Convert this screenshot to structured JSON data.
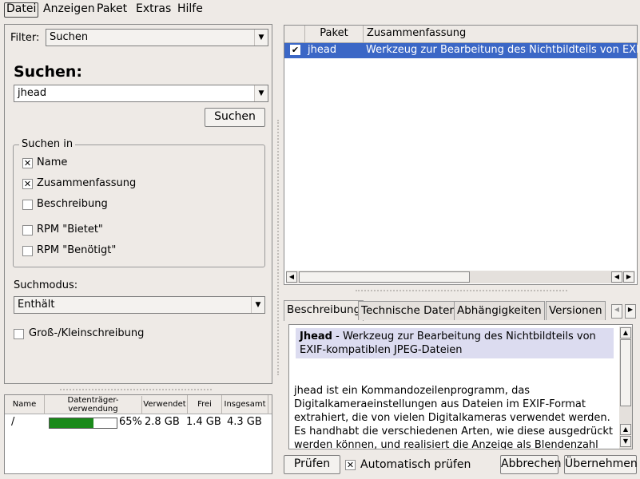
{
  "menu": {
    "items": [
      "Datei",
      "Anzeigen",
      "Paket",
      "Extras",
      "Hilfe"
    ]
  },
  "left": {
    "filter_label": "Filter:",
    "filter_value": "Suchen",
    "search_heading": "Suchen:",
    "search_value": "jhead",
    "search_button": "Suchen",
    "group_title": "Suchen in",
    "options": [
      {
        "label": "Name",
        "checked": true
      },
      {
        "label": "Zusammenfassung",
        "checked": true
      },
      {
        "label": "Beschreibung",
        "checked": false
      },
      {
        "label": "RPM \"Bietet\"",
        "checked": false
      },
      {
        "label": "RPM \"Benötigt\"",
        "checked": false
      }
    ],
    "mode_label": "Suchmodus:",
    "mode_value": "Enthält",
    "case_label": "Groß-/Kleinschreibung",
    "case_checked": false
  },
  "disk": {
    "headers": [
      "Name",
      "Datenträger-verwendung",
      "Verwendet",
      "Frei",
      "Insgesamt"
    ],
    "row": {
      "name": "/",
      "percent": "65%",
      "used": "2.8 GB",
      "free": "1.4 GB",
      "total": "4.3 GB",
      "fill": 0.65
    }
  },
  "packages": {
    "headers": [
      "Paket",
      "Zusammenfassung"
    ],
    "rows": [
      {
        "checked": true,
        "name": "jhead",
        "summary": "Werkzeug zur Bearbeitung des Nichtbildteils von EXIF"
      }
    ]
  },
  "tabs": [
    "Beschreibung",
    "Technische Daten",
    "Abhängigkeiten",
    "Versionen"
  ],
  "description": {
    "title_bold": "Jhead",
    "title_rest": " - Werkzeug zur Bearbeitung des Nichtbildteils von EXIF-kompatiblen JPEG-Dateien",
    "body": "jhead ist ein Kommandozeilenprogramm, das Digitalkameraeinstellungen aus Dateien im EXIF-Format extrahiert, die von vielen Digitalkameras verwendet werden. Es handhabt die verschiedenen Arten, wie diese ausgedrückt werden können, und realisiert die Anzeige als Blendenzahl"
  },
  "bottom": {
    "check_button": "Prüfen",
    "auto_check_label": "Automatisch prüfen",
    "auto_check": true,
    "cancel_button": "Abbrechen",
    "apply_button": "Übernehmen"
  },
  "colors": {
    "selection": "#3b67c6",
    "disk_bar": "#1a8a1a"
  }
}
